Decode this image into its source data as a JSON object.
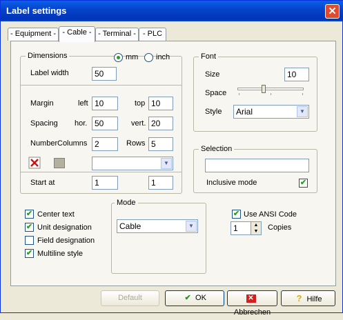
{
  "window": {
    "title": "Label settings",
    "close_label": "✕"
  },
  "tabs": [
    "- Equipment -",
    "- Cable -",
    "- Terminal -",
    "- PLC"
  ],
  "dimensions": {
    "group_label": "Dimensions",
    "unit_mm": "mm",
    "unit_inch": "inch",
    "label_width_label": "Label width",
    "label_width_value": "50",
    "margin_label": "Margin",
    "left_label": "left",
    "left_value": "10",
    "top_label": "top",
    "top_value": "10",
    "spacing_label": "Spacing",
    "hor_label": "hor.",
    "hor_value": "50",
    "vert_label": "vert.",
    "vert_value": "20",
    "number_label": "Number",
    "columns_label": "Columns",
    "columns_value": "2",
    "rows_label": "Rows",
    "rows_value": "5",
    "combo_value": "",
    "start_label": "Start at",
    "start_value_1": "1",
    "start_value_2": "1"
  },
  "font": {
    "group_label": "Font",
    "size_label": "Size",
    "size_value": "10",
    "space_label": "Space",
    "style_label": "Style",
    "style_value": "Arial"
  },
  "selection": {
    "group_label": "Selection",
    "input_value": "",
    "inclusive_label": "Inclusive mode",
    "inclusive_checked": true
  },
  "options": {
    "center_text": "Center text",
    "unit_designation": "Unit designation",
    "field_designation": "Field designation",
    "multiline_style": "Multiline style"
  },
  "mode": {
    "group_label": "Mode",
    "value": "Cable"
  },
  "ansi": {
    "use_ansi_label": "Use ANSI Code",
    "copies_value": "1",
    "copies_label": "Copies"
  },
  "buttons": {
    "default": "Default",
    "ok": "OK",
    "cancel": "Abbrechen",
    "help": "Hilfe"
  }
}
